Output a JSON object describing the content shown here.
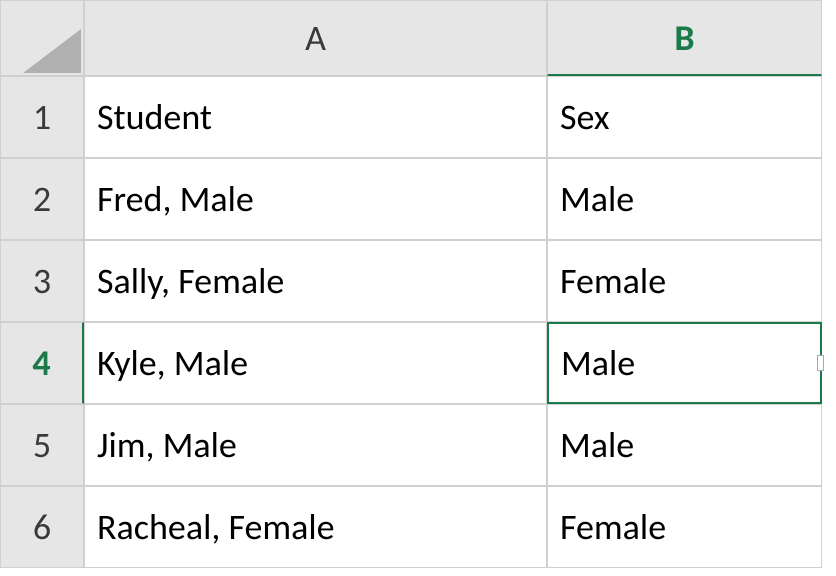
{
  "colors": {
    "accent": "#1a7a49",
    "header_bg": "#e6e6e6",
    "grid_line": "#d0d0d0"
  },
  "active_cell": "B4",
  "columns": [
    {
      "label": "A",
      "active": false
    },
    {
      "label": "B",
      "active": true
    }
  ],
  "rows": [
    {
      "label": "1",
      "active": false
    },
    {
      "label": "2",
      "active": false
    },
    {
      "label": "3",
      "active": false
    },
    {
      "label": "4",
      "active": true
    },
    {
      "label": "5",
      "active": false
    },
    {
      "label": "6",
      "active": false
    }
  ],
  "cells": {
    "A1": "Student",
    "B1": "Sex",
    "A2": "Fred, Male",
    "B2": "Male",
    "A3": "Sally, Female",
    "B3": "Female",
    "A4": "Kyle, Male",
    "B4": "Male",
    "A5": "Jim, Male",
    "B5": "Male",
    "A6": "Racheal, Female",
    "B6": "Female"
  },
  "chart_data": {
    "type": "table",
    "title": "",
    "columns": [
      "Student",
      "Sex"
    ],
    "rows": [
      [
        "Fred, Male",
        "Male"
      ],
      [
        "Sally, Female",
        "Female"
      ],
      [
        "Kyle, Male",
        "Male"
      ],
      [
        "Jim, Male",
        "Male"
      ],
      [
        "Racheal, Female",
        "Female"
      ]
    ]
  }
}
